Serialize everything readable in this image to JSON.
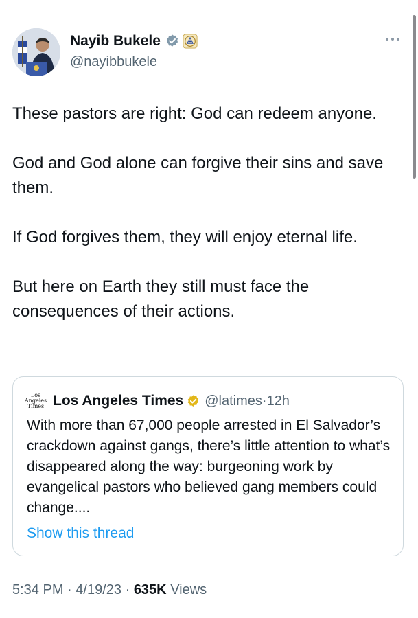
{
  "tweet": {
    "author": {
      "display_name": "Nayib Bukele",
      "handle": "@nayibbukele",
      "avatar_icon": "profile-photo-avatar",
      "verified_icon": "verified-badge-icon",
      "affiliate_icon": "government-seal-icon"
    },
    "more_icon": "more-options-icon",
    "paragraphs": [
      "These pastors are right:  God can redeem anyone.",
      "God and God alone can forgive their sins and save them.",
      "If God forgives them, they will enjoy eternal life.",
      "But here on Earth they still must face the consequences of their actions."
    ],
    "quoted": {
      "logo_text": [
        "Los",
        "Angeles",
        "Times"
      ],
      "display_name": "Los Angeles Times",
      "verified_icon": "gold-verified-badge-icon",
      "handle": "@latimes",
      "separator": "·",
      "time": "12h",
      "text": "With more than 67,000 people arrested in El Salvador’s crackdown against gangs, there’s little attention to what’s disappeared along the way: burgeoning work by evangelical pastors who believed gang members could change....",
      "show_thread": "Show this thread"
    },
    "meta": {
      "time": "5:34 PM",
      "separator": "·",
      "date": "4/19/23",
      "views_count": "635K",
      "views_label": "Views"
    }
  },
  "colors": {
    "text": "#0f1419",
    "secondary": "#536471",
    "link": "#1d9bf0",
    "verified_blue": "#829aab",
    "verified_gold": "#e2b719",
    "border": "#cfd9de"
  }
}
